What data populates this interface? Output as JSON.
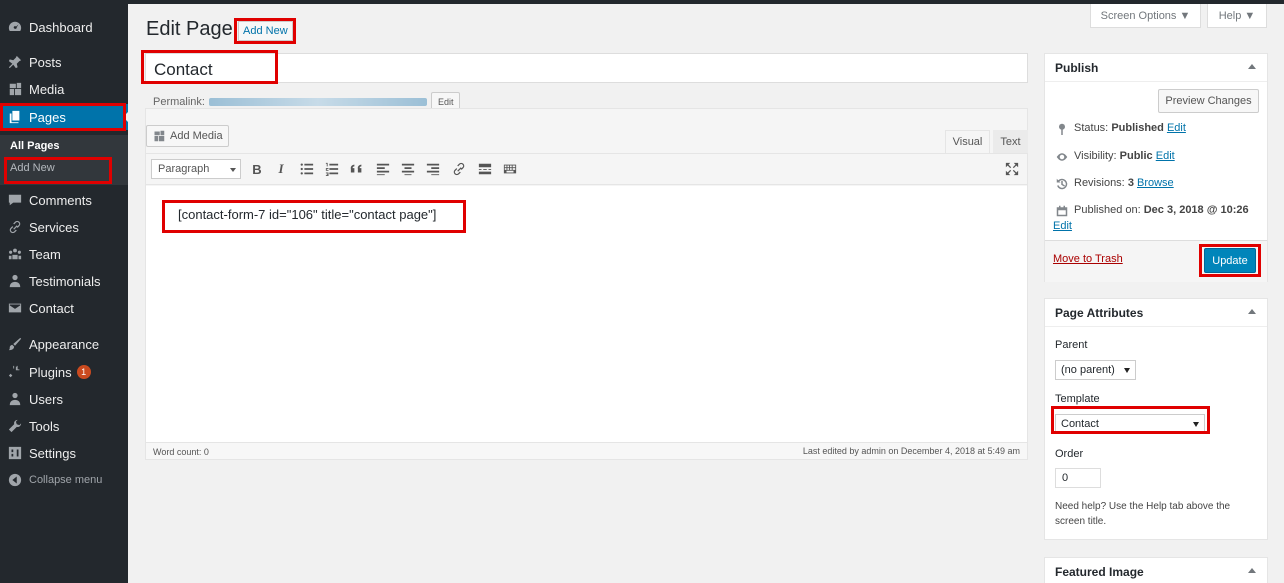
{
  "sidebar": {
    "items": [
      {
        "label": "Dashboard",
        "icon": "dashboard-icon"
      },
      {
        "label": "Posts",
        "icon": "pushpin-icon"
      },
      {
        "label": "Media",
        "icon": "media-icon"
      },
      {
        "label": "Pages",
        "icon": "pages-icon"
      },
      {
        "label": "Comments",
        "icon": "comment-icon"
      },
      {
        "label": "Services",
        "icon": "link-icon"
      },
      {
        "label": "Team",
        "icon": "groups-icon"
      },
      {
        "label": "Testimonials",
        "icon": "person-icon"
      },
      {
        "label": "Contact",
        "icon": "envelope-icon"
      },
      {
        "label": "Appearance",
        "icon": "brush-icon"
      },
      {
        "label": "Plugins",
        "icon": "plugin-icon",
        "badge": "1"
      },
      {
        "label": "Users",
        "icon": "users-icon"
      },
      {
        "label": "Tools",
        "icon": "wrench-icon"
      },
      {
        "label": "Settings",
        "icon": "settings-icon"
      }
    ],
    "submenu": {
      "all_pages": "All Pages",
      "add_new": "Add New"
    },
    "collapse": "Collapse menu"
  },
  "header": {
    "screen_options": "Screen Options ▼",
    "help": "Help ▼",
    "title": "Edit Page",
    "add_new": "Add New"
  },
  "editor": {
    "post_title": "Contact",
    "permalink_label": "Permalink:",
    "permalink_edit": "Edit",
    "add_media": "Add Media",
    "tab_visual": "Visual",
    "tab_text": "Text",
    "format_select": "Paragraph",
    "content": "[contact-form-7 id=\"106\" title=\"contact page\"]",
    "word_count": "Word count: 0",
    "last_edited": "Last edited by admin on December 4, 2018 at 5:49 am"
  },
  "publish": {
    "title": "Publish",
    "preview": "Preview Changes",
    "status_label": "Status:",
    "status_value": "Published",
    "visibility_label": "Visibility:",
    "visibility_value": "Public",
    "revisions_label": "Revisions:",
    "revisions_value": "3",
    "browse": "Browse",
    "published_label": "Published on:",
    "published_value": "Dec 3, 2018 @ 10:26",
    "edit": "Edit",
    "trash": "Move to Trash",
    "update": "Update"
  },
  "attributes": {
    "title": "Page Attributes",
    "parent_label": "Parent",
    "parent_value": "(no parent)",
    "template_label": "Template",
    "template_value": "Contact",
    "order_label": "Order",
    "order_value": "0",
    "help": "Need help? Use the Help tab above the screen title."
  },
  "featured": {
    "title": "Featured Image"
  },
  "colors": {
    "accent": "#0073aa",
    "sidebar": "#23282d",
    "highlight": "#e00000"
  }
}
